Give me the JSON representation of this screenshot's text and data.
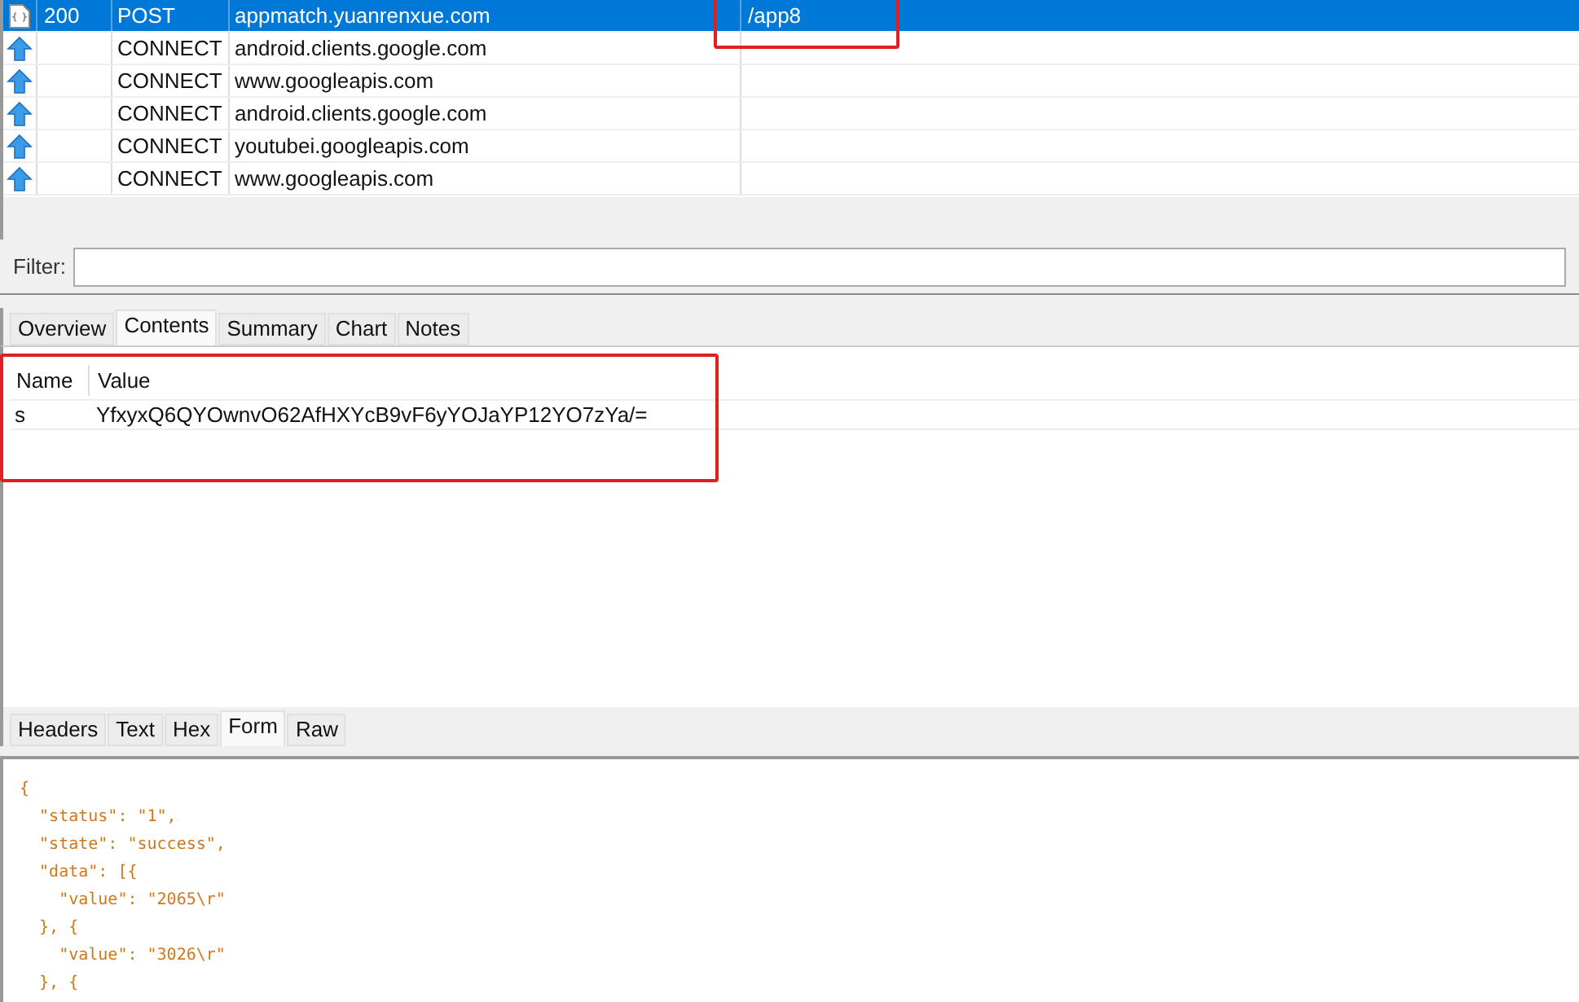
{
  "sessions": [
    {
      "kind": "json",
      "result": "200",
      "protocol": "POST",
      "host": "appmatch.yuanrenxue.com",
      "url": "/app8",
      "selected": true,
      "highlighted": true
    },
    {
      "kind": "tunnel",
      "protocol": "CONNECT",
      "host": "android.clients.google.com",
      "selected": false
    },
    {
      "kind": "tunnel",
      "protocol": "CONNECT",
      "host": "www.googleapis.com",
      "selected": false
    },
    {
      "kind": "tunnel",
      "protocol": "CONNECT",
      "host": "android.clients.google.com",
      "selected": false
    },
    {
      "kind": "tunnel",
      "protocol": "CONNECT",
      "host": "youtubei.googleapis.com",
      "selected": false
    },
    {
      "kind": "tunnel",
      "protocol": "CONNECT",
      "host": "www.googleapis.com",
      "selected": false
    }
  ],
  "filter": {
    "label": "Filter:"
  },
  "request_tabs": [
    {
      "label": "Overview",
      "selected": false
    },
    {
      "label": "Contents",
      "selected": true
    },
    {
      "label": "Summary",
      "selected": false
    },
    {
      "label": "Chart",
      "selected": false
    },
    {
      "label": "Notes",
      "selected": false
    }
  ],
  "form_table": {
    "highlighted": true,
    "columns": [
      "Name",
      "Value"
    ],
    "rows": [
      [
        "s",
        "YfxyxQ6QYOwnvO62AfHXYcB9vF6yYOJaYP12YO7zYa/="
      ]
    ]
  },
  "response_tabs": [
    {
      "label": "Headers",
      "selected": false
    },
    {
      "label": "Text",
      "selected": false
    },
    {
      "label": "Hex",
      "selected": false
    },
    {
      "label": "Form",
      "selected": true
    },
    {
      "label": "Raw",
      "selected": false
    }
  ],
  "response_body": [
    "{",
    "  \"status\": \"1\",",
    "  \"state\": \"success\",",
    "  \"data\": [{",
    "    \"value\": \"2065\\r\"",
    "  }, {",
    "    \"value\": \"3026\\r\"",
    "  }, {"
  ]
}
